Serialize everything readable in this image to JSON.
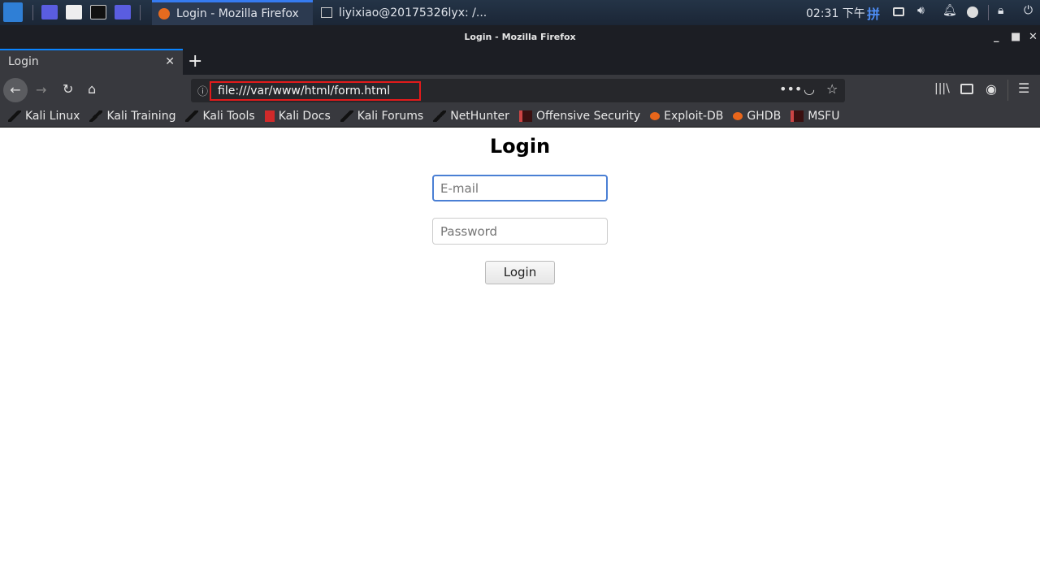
{
  "taskbar": {
    "tasks": [
      {
        "label": "Login - Mozilla Firefox",
        "active": true
      },
      {
        "label": "liyixiao@20175326lyx: /..."
      }
    ],
    "clock": "02:31 下午",
    "ime": "拼",
    "accent": "#367bf0"
  },
  "window": {
    "title": "Login - Mozilla Firefox"
  },
  "browser": {
    "tab_label": "Login",
    "url": "file:///var/www/html/form.html",
    "bookmarks": [
      "Kali Linux",
      "Kali Training",
      "Kali Tools",
      "Kali Docs",
      "Kali Forums",
      "NetHunter",
      "Offensive Security",
      "Exploit-DB",
      "GHDB",
      "MSFU"
    ]
  },
  "page": {
    "heading": "Login",
    "email_placeholder": "E-mail",
    "password_placeholder": "Password",
    "button": "Login"
  },
  "highlight_color": "#e21b1b"
}
